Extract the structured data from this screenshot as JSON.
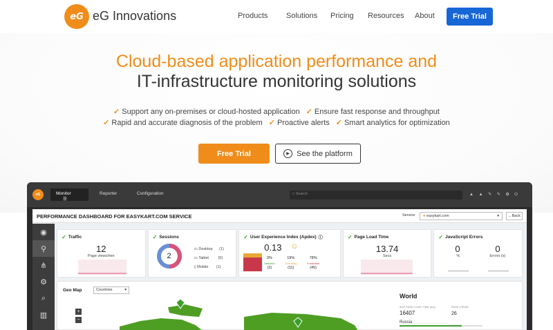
{
  "nav": {
    "logo_mark": "eG",
    "brand": "eG Innovations",
    "links": [
      "Products",
      "Solutions",
      "Pricing",
      "Resources",
      "About"
    ],
    "cta": "Free Trial"
  },
  "hero": {
    "headline_orange": "Cloud-based application performance and",
    "headline_dark": "IT-infrastructure monitoring solutions",
    "features_row1": [
      "Support any on-premises or cloud-hosted application",
      "Ensure fast response and throughput"
    ],
    "features_row2": [
      "Rapid and accurate diagnosis of the problem",
      "Proactive alerts",
      "Smart analytics for optimization"
    ],
    "primary_button": "Free Trial",
    "secondary_button": "See the platform"
  },
  "dashboard": {
    "logo_mark": "eG",
    "tabs": [
      "Monitor",
      "Reporter",
      "Configuration"
    ],
    "search_placeholder": "Search",
    "title": "PERFORMANCE DASHBOARD FOR EASYKART.COM SERVICE",
    "service_label": "Service",
    "service_value": "easykart.com",
    "back_label": "Back",
    "kpis": {
      "traffic": {
        "title": "Traffic",
        "value": "12",
        "unit": "Page views/min"
      },
      "sessions": {
        "title": "Sessions",
        "total": "2",
        "devices": [
          {
            "name": "Desktop",
            "count": "(1)"
          },
          {
            "name": "Tablet",
            "count": "(0)"
          },
          {
            "name": "Mobile",
            "count": "(1)"
          }
        ]
      },
      "apdex": {
        "title": "User Experience Index (Apdex)",
        "value": "0.13",
        "buckets": [
          {
            "pct": "3%",
            "label": "Satisfied",
            "count": "(2)"
          },
          {
            "pct": "19%",
            "label": "Tolerating",
            "count": "(11)"
          },
          {
            "pct": "78%",
            "label": "Frustrated",
            "count": "(45)"
          }
        ]
      },
      "page_load": {
        "title": "Page Load Time",
        "value": "13.74",
        "unit": "Secs"
      },
      "js_errors": {
        "title": "JavaScript Errors",
        "pct_value": "0",
        "pct_unit": "%",
        "err_value": "0",
        "err_unit": "Errors (s)"
      }
    },
    "geo": {
      "label": "Geo Map",
      "select": "Countries",
      "world_title": "World",
      "avg_label": "AVG PAGE LOAD TIME (ms)",
      "avg_value": "16407",
      "views_label": "PAGE VIEWS",
      "views_value": "26",
      "country": "Russia"
    }
  },
  "colors": {
    "orange": "#f08c1a",
    "blue": "#1766d6",
    "green": "#3a9f2a",
    "pink": "#d9527a"
  }
}
